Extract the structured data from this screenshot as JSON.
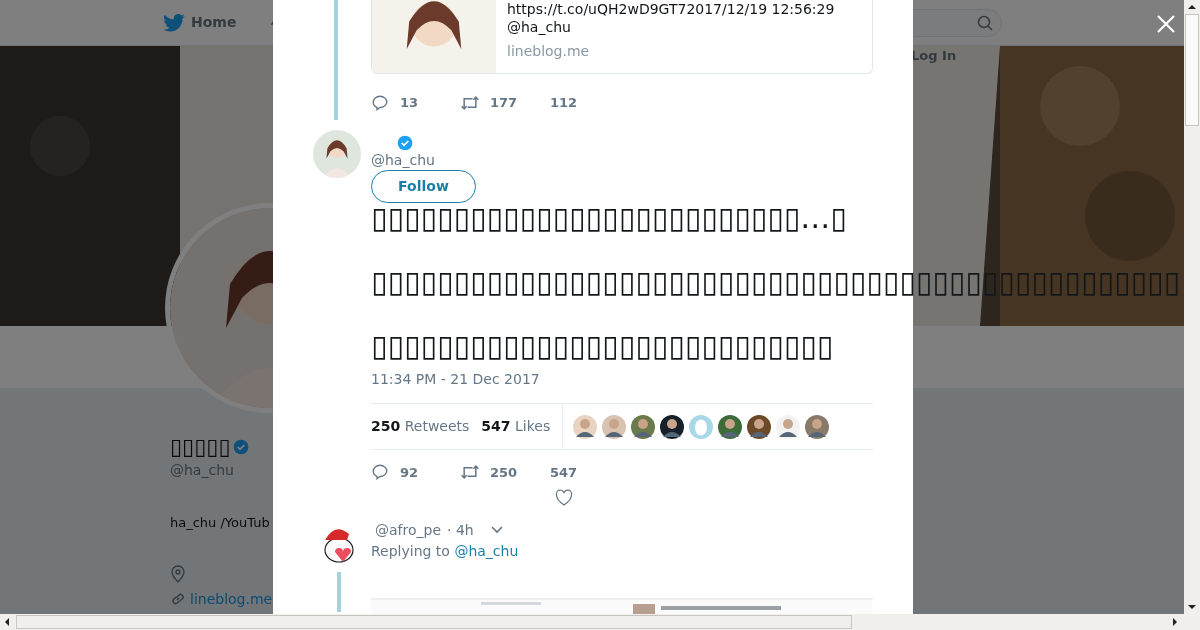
{
  "nav": {
    "home": "Home",
    "login": "Log In"
  },
  "profile": {
    "name": "▯▯▯▯▯",
    "verified": true,
    "handle": "@ha_chu",
    "bio": "ha_chu /YouTub",
    "link": "lineblog.me"
  },
  "link_card": {
    "url_text": "https://t.co/uQH2wD9GT72017/12/19 12:56:29",
    "handle": "@ha_chu",
    "domain": "lineblog.me"
  },
  "prev_actions": {
    "replies": "13",
    "retweets": "177",
    "likes": "112"
  },
  "tweet": {
    "verified": true,
    "handle": "@ha_chu",
    "follow": "Follow",
    "lines": [
      "▯▯▯▯▯▯▯▯▯▯▯▯▯▯▯▯▯▯▯▯▯▯▯▯▯▯…▯",
      "▯▯▯▯▯▯▯▯▯▯▯▯▯▯▯▯▯▯▯▯▯▯▯▯▯▯▯▯▯▯▯▯▯▯▯▯▯▯▯▯▯▯▯▯▯▯▯▯▯",
      "▯▯▯▯▯▯▯▯▯▯▯▯▯▯▯▯▯▯▯▯▯▯▯▯▯▯▯▯"
    ],
    "time": "11:34 PM - 21 Dec 2017",
    "retweets_count": "250",
    "retweets_label": "Retweets",
    "likes_count": "547",
    "likes_label": "Likes",
    "likers": [
      {
        "kind": "picture",
        "color": "#e8d4c0"
      },
      {
        "kind": "picture",
        "color": "#d9c2b0"
      },
      {
        "kind": "picture",
        "color": "#6b7a4a"
      },
      {
        "kind": "picture",
        "color": "#15202b"
      },
      {
        "kind": "egg",
        "color": "#a8d8e8"
      },
      {
        "kind": "picture",
        "color": "#3e6b3a"
      },
      {
        "kind": "picture",
        "color": "#6b4a2a"
      },
      {
        "kind": "picture",
        "color": "#f2f2f2"
      },
      {
        "kind": "picture",
        "color": "#8a7a6a"
      }
    ],
    "actions": {
      "replies": "92",
      "retweets": "250",
      "likes": "547"
    }
  },
  "reply": {
    "handle": "@afro_pe",
    "time": "· 4h",
    "replying_label": "Replying to",
    "replying_to": "@ha_chu"
  }
}
